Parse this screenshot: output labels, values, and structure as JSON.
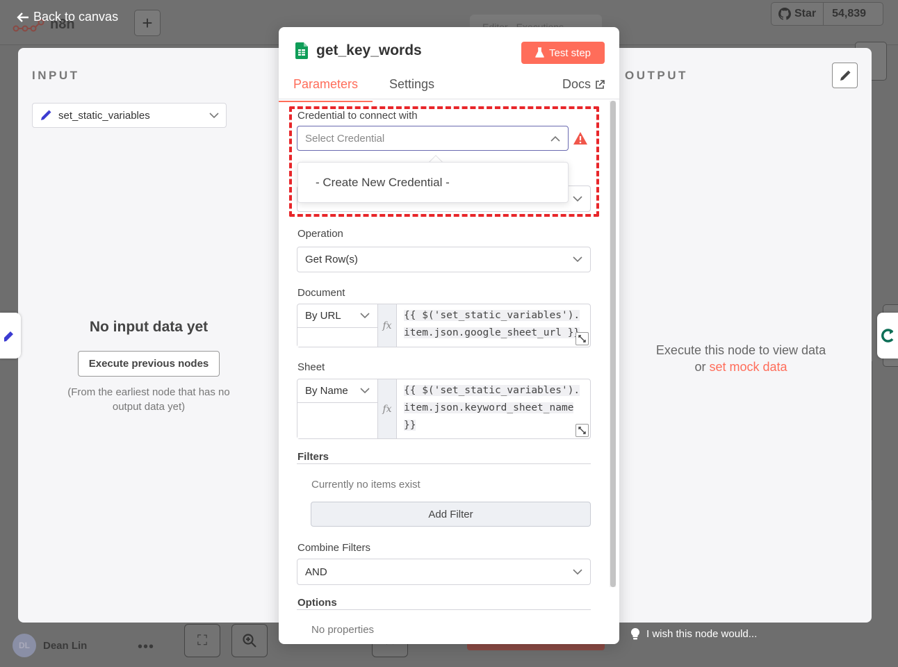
{
  "background": {
    "app_name": "n8n",
    "back_label": "Back to canvas",
    "tabs": [
      "Editor",
      "Executions"
    ],
    "github": {
      "label": "Star",
      "count": "54,839"
    },
    "user": {
      "initials": "DL",
      "name": "Dean Lin"
    },
    "wish_label": "I wish this node would..."
  },
  "input_pane": {
    "title": "INPUT",
    "source_node": "set_static_variables",
    "empty_title": "No input data yet",
    "execute_button": "Execute previous nodes",
    "hint": "(From the earliest node that has no output data yet)"
  },
  "output_pane": {
    "title": "OUTPUT",
    "message": "Execute this node to view data",
    "or": "or",
    "mock_link": "set mock data"
  },
  "node": {
    "name": "get_key_words",
    "test_button": "Test step",
    "tabs": {
      "parameters": "Parameters",
      "settings": "Settings",
      "docs": "Docs"
    }
  },
  "form": {
    "credential": {
      "label": "Credential to connect with",
      "placeholder": "Select Credential",
      "dropdown_option": "- Create New Credential -"
    },
    "operation": {
      "label": "Operation",
      "value": "Get Row(s)"
    },
    "document": {
      "label": "Document",
      "mode": "By URL",
      "expr_line1": "{{ $('set_static_variables').",
      "expr_line2": "item.json.google_sheet_url }}"
    },
    "sheet": {
      "label": "Sheet",
      "mode": "By Name",
      "expr_line1": "{{ $('set_static_variables').",
      "expr_line2": "item.json.keyword_sheet_name",
      "expr_line3": "}}"
    },
    "filters": {
      "title": "Filters",
      "empty": "Currently no items exist",
      "add_button": "Add Filter"
    },
    "combine": {
      "label": "Combine Filters",
      "value": "AND"
    },
    "options": {
      "title": "Options",
      "empty": "No properties"
    }
  },
  "colors": {
    "accent": "#ff6d5a",
    "highlight": "#e8262a",
    "sheets_green": "#0f9d58"
  }
}
